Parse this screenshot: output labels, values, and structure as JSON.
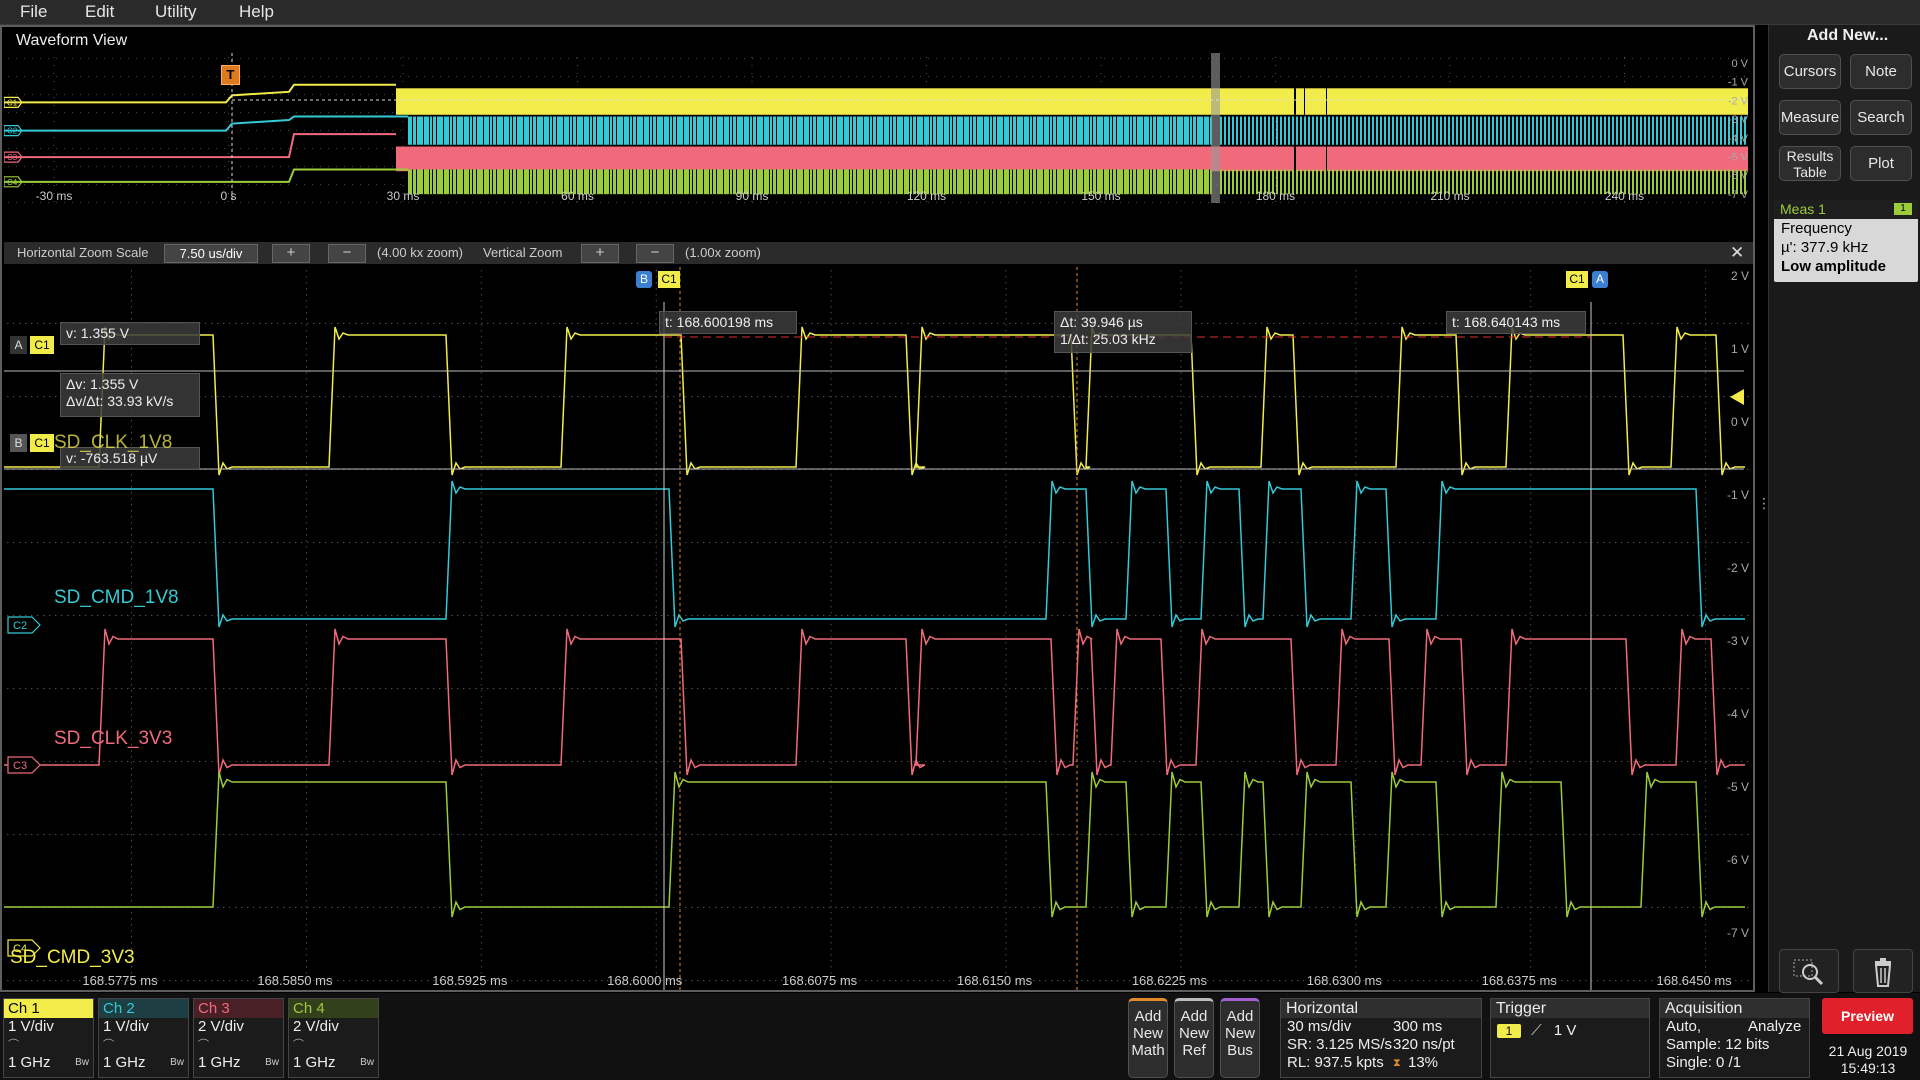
{
  "menu": {
    "file": "File",
    "edit": "Edit",
    "utility": "Utility",
    "help": "Help"
  },
  "waveform_view": {
    "title": "Waveform View"
  },
  "overview": {
    "time_labels": [
      "-30 ms",
      "0 s",
      "30 ms",
      "60 ms",
      "90 ms",
      "120 ms",
      "150 ms",
      "180 ms",
      "210 ms",
      "240 ms"
    ],
    "volt_labels": [
      "0 V",
      "-1 V",
      "-2 V",
      "-3 V",
      "-4 V",
      "-5 V",
      "-6 V",
      "-7 V"
    ],
    "trigger_marker": "T"
  },
  "zoom_bar": {
    "h_label": "Horizontal Zoom Scale",
    "h_value": "7.50 us/div",
    "h_zoom": "(4.00 kx zoom)",
    "v_label": "Vertical Zoom",
    "v_zoom": "(1.00x zoom)",
    "plus": "+",
    "minus": "−",
    "close": "✕"
  },
  "zoom": {
    "time_labels": [
      "168.5775 ms",
      "168.5850 ms",
      "168.5925 ms",
      "168.6000 ms",
      "168.6075 ms",
      "168.6150 ms",
      "168.6225 ms",
      "168.6300 ms",
      "168.6375 ms",
      "168.6450 ms"
    ],
    "volt_labels": [
      "2 V",
      "1 V",
      "0 V",
      "-1 V",
      "-2 V",
      "-3 V",
      "-4 V",
      "-5 V",
      "-6 V",
      "-7 V"
    ],
    "channel_labels": {
      "c1": "SD_CLK_1V8",
      "c2": "SD_CMD_1V8",
      "c3": "SD_CLK_3V3",
      "c4": "SD_CMD_3V3"
    },
    "cursor_a_label": "A",
    "cursor_b_label": "B",
    "cursor_src": "C1",
    "readouts": {
      "a_v": "v: 1.355 V",
      "delta_v": "Δv: 1.355 V",
      "dv_dt": "Δv/Δt: 33.93 kV/s",
      "b_v": "v: -763.518 µV",
      "b_t": "t: 168.600198 ms",
      "delta_t": "Δt: 39.946 µs",
      "inv_dt": "1/Δt: 25.03 kHz",
      "a_t": "t: 168.640143 ms"
    }
  },
  "right_panel": {
    "add_new": "Add New...",
    "buttons": {
      "cursors": "Cursors",
      "note": "Note",
      "measure": "Measure",
      "search": "Search",
      "results_line1": "Results",
      "results_line2": "Table",
      "plot": "Plot"
    },
    "meas": {
      "title": "Meas 1",
      "badge": "1",
      "name": "Frequency",
      "value": "µ': 377.9 kHz",
      "warning": "Low amplitude"
    }
  },
  "channels": [
    {
      "name": "Ch 1",
      "scale": "1 V/div",
      "bw": "1 GHz",
      "color": "#f2ec4a"
    },
    {
      "name": "Ch 2",
      "scale": "1 V/div",
      "bw": "1 GHz",
      "color": "#33c9d6"
    },
    {
      "name": "Ch 3",
      "scale": "2 V/div",
      "bw": "1 GHz",
      "color": "#f06a7c"
    },
    {
      "name": "Ch 4",
      "scale": "2 V/div",
      "bw": "1 GHz",
      "color": "#9ccc3a"
    }
  ],
  "add_buttons": {
    "math": [
      "Add",
      "New",
      "Math"
    ],
    "ref": [
      "Add",
      "New",
      "Ref"
    ],
    "bus": [
      "Add",
      "New",
      "Bus"
    ]
  },
  "horizontal": {
    "title": "Horizontal",
    "scale": "30 ms/div",
    "position": "300 ms",
    "sr": "SR: 3.125 MS/s",
    "res": "320 ns/pt",
    "rl": "RL: 937.5 kpts",
    "pct": "13%"
  },
  "trigger": {
    "title": "Trigger",
    "source": "1",
    "level": "1 V"
  },
  "acquisition": {
    "title": "Acquisition",
    "mode": "Auto,",
    "analyze": "Analyze",
    "sample": "Sample: 12 bits",
    "single": "Single: 0 /1"
  },
  "preview": "Preview",
  "datetime": {
    "date": "21 Aug 2019",
    "time": "15:49:13"
  },
  "colors": {
    "ch1": "#f2ec4a",
    "ch2": "#33c9d6",
    "ch3": "#f06a7c",
    "ch4": "#9ccc3a",
    "cursor_a": "#4a90d9",
    "preview": "#e0202a"
  }
}
